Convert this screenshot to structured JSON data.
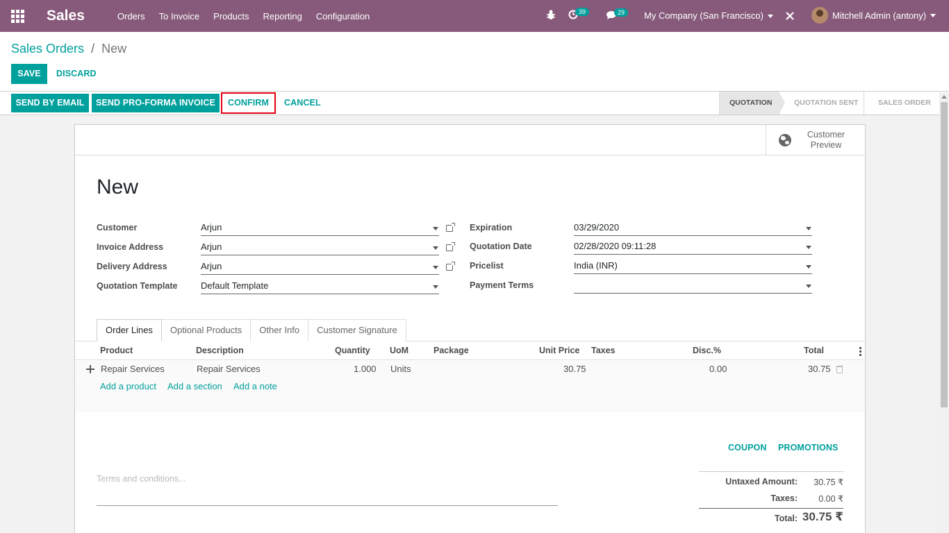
{
  "navbar": {
    "app_name": "Sales",
    "menu": [
      "Orders",
      "To Invoice",
      "Products",
      "Reporting",
      "Configuration"
    ],
    "activity_count": "39",
    "message_count": "29",
    "company": "My Company (San Francisco)",
    "user": "Mitchell Admin (antony)",
    "brand_color": "#875a7b"
  },
  "breadcrumb": {
    "parent": "Sales Orders",
    "separator": "/",
    "current": "New"
  },
  "control": {
    "save": "SAVE",
    "discard": "DISCARD"
  },
  "statusbar": {
    "send_email": "SEND BY EMAIL",
    "send_proforma": "SEND PRO-FORMA INVOICE",
    "confirm": "CONFIRM",
    "cancel": "CANCEL",
    "stages": [
      "QUOTATION",
      "QUOTATION SENT",
      "SALES ORDER"
    ],
    "active_stage": "QUOTATION"
  },
  "form": {
    "preview_label": "Customer Preview",
    "title": "New",
    "left_fields": [
      {
        "label": "Customer",
        "value": "Arjun"
      },
      {
        "label": "Invoice Address",
        "value": "Arjun"
      },
      {
        "label": "Delivery Address",
        "value": "Arjun"
      },
      {
        "label": "Quotation Template",
        "value": "Default Template"
      }
    ],
    "right_fields": [
      {
        "label": "Expiration",
        "value": "03/29/2020"
      },
      {
        "label": "Quotation Date",
        "value": "02/28/2020 09:11:28"
      },
      {
        "label": "Pricelist",
        "value": "India (INR)"
      },
      {
        "label": "Payment Terms",
        "value": ""
      }
    ],
    "tabs": [
      "Order Lines",
      "Optional Products",
      "Other Info",
      "Customer Signature"
    ],
    "active_tab": "Order Lines"
  },
  "order_lines": {
    "columns": [
      "Product",
      "Description",
      "Quantity",
      "UoM",
      "Package",
      "Unit Price",
      "Taxes",
      "Disc.%",
      "Total"
    ],
    "rows": [
      {
        "product": "Repair Services",
        "description": "Repair Services",
        "quantity": "1.000",
        "uom": "Units",
        "package": "",
        "unit_price": "30.75",
        "taxes": "",
        "discount": "0.00",
        "total": "30.75"
      }
    ],
    "add_product": "Add a product",
    "add_section": "Add a section",
    "add_note": "Add a note"
  },
  "actions": {
    "coupon": "COUPON",
    "promotions": "PROMOTIONS"
  },
  "terms_placeholder": "Terms and conditions...",
  "totals": {
    "untaxed_label": "Untaxed Amount:",
    "untaxed_value": "30.75 ₹",
    "taxes_label": "Taxes:",
    "taxes_value": "0.00 ₹",
    "total_label": "Total:",
    "total_value": "30.75 ₹"
  },
  "accent_color": "#00a09d",
  "highlight_color": "#e3000f"
}
